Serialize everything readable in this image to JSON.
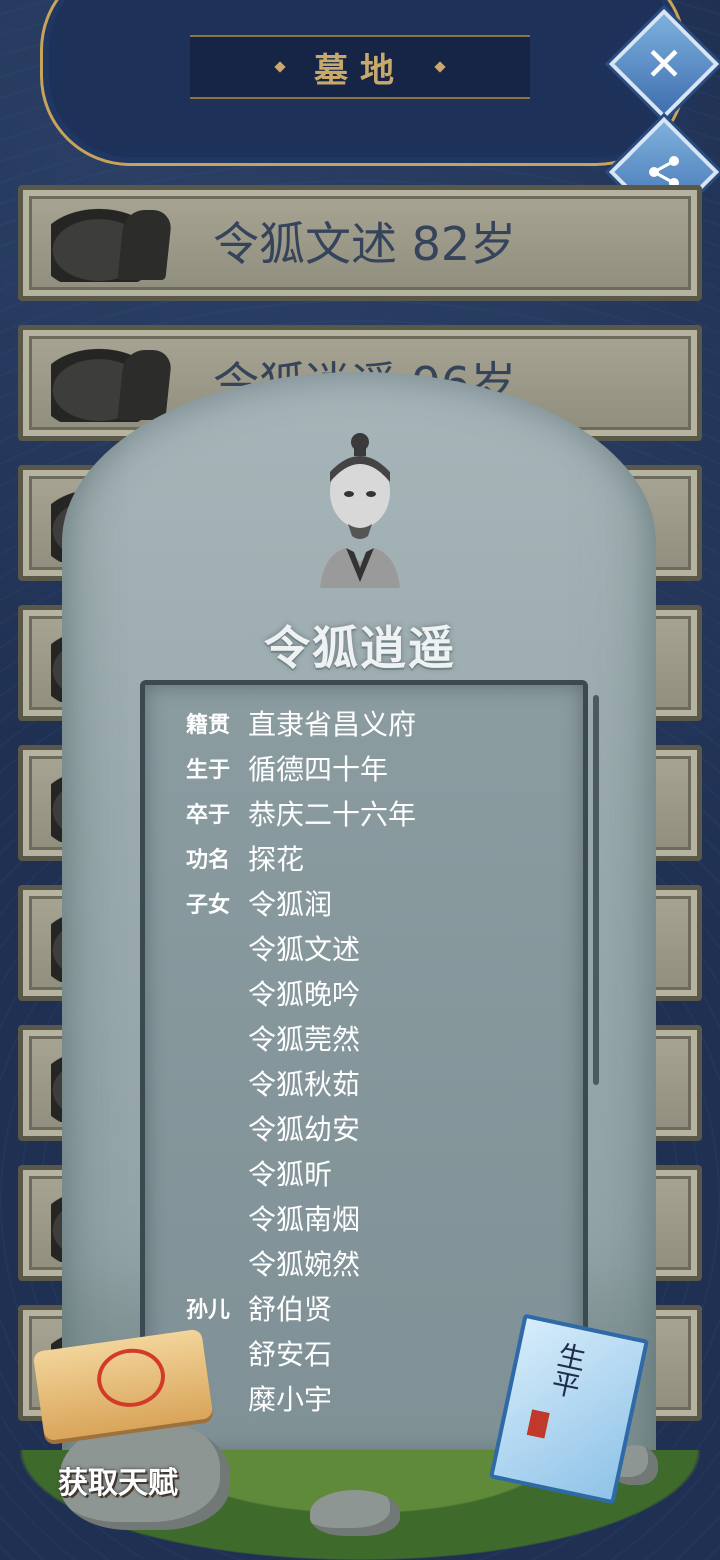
{
  "header": {
    "title": "墓地"
  },
  "buttons": {
    "close": "✕"
  },
  "graves": [
    {
      "name": "令狐文述",
      "age": "82岁"
    },
    {
      "name": "令狐逍遥",
      "age": "96岁"
    }
  ],
  "tombstone": {
    "name": "令狐逍遥",
    "fields": [
      {
        "label": "籍贯",
        "value": "直隶省昌义府"
      },
      {
        "label": "生于",
        "value": "循德四十年"
      },
      {
        "label": "卒于",
        "value": "恭庆二十六年"
      },
      {
        "label": "功名",
        "value": "探花"
      }
    ],
    "children_label": "子女",
    "children": [
      "令狐润",
      "令狐文述",
      "令狐晚吟",
      "令狐莞然",
      "令狐秋茹",
      "令狐幼安",
      "令狐昕",
      "令狐南烟",
      "令狐婉然"
    ],
    "grandchildren_label": "孙儿",
    "grandchildren": [
      "舒伯贤",
      "舒安石",
      "糜小宇"
    ]
  },
  "footer": {
    "talent_button": "获取天赋",
    "book_title": "生平"
  }
}
